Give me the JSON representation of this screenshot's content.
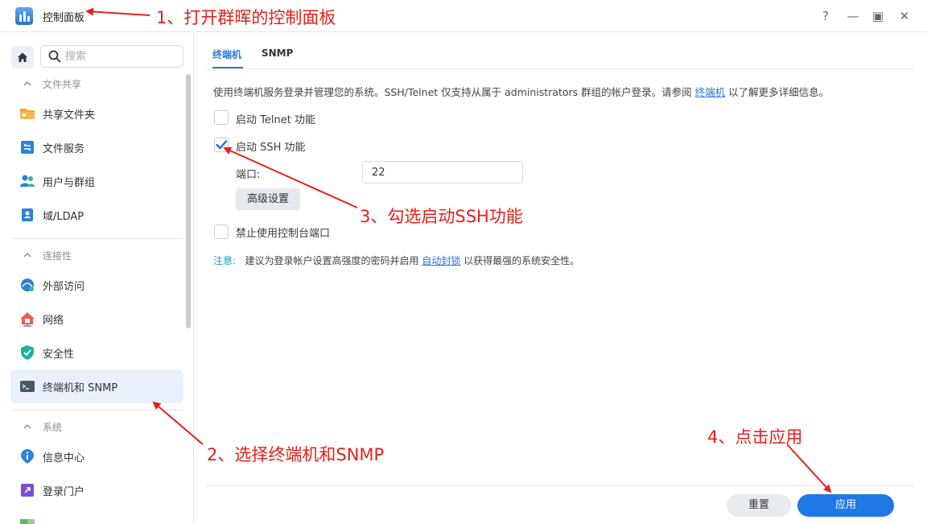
{
  "window": {
    "title": "控制面板",
    "buttons": {
      "help": "?",
      "minimize": "—",
      "maximize": "▣",
      "close": "✕"
    }
  },
  "sidebar": {
    "search_placeholder": "搜索",
    "groups": [
      {
        "label": "文件共享",
        "items": [
          "共享文件夹",
          "文件服务",
          "用户与群组",
          "域/LDAP"
        ]
      },
      {
        "label": "连接性",
        "items": [
          "外部访问",
          "网络",
          "安全性",
          "终端机和 SNMP"
        ]
      },
      {
        "label": "系统",
        "items": [
          "信息中心",
          "登录门户"
        ]
      }
    ],
    "active_item": "终端机和 SNMP"
  },
  "main": {
    "tabs": [
      "终端机",
      "SNMP"
    ],
    "active_tab": "终端机",
    "description": {
      "before": "使用终端机服务登录并管理您的系统。SSH/Telnet 仅支持从属于 administrators 群组的帐户登录。请参阅 ",
      "link": "终端机",
      "after": " 以了解更多详细信息。"
    },
    "telnet": {
      "label": "启动 Telnet 功能",
      "checked": false
    },
    "ssh": {
      "label": "启动 SSH 功能",
      "checked": true
    },
    "port": {
      "label": "端口:",
      "value": "22"
    },
    "advanced_button": "高级设置",
    "console": {
      "label": "禁止使用控制台端口",
      "checked": false
    },
    "note": {
      "label": "注意:",
      "before": "建议为登录帐户设置高强度的密码并启用 ",
      "link": "自动封锁",
      "after": " 以获得最强的系统安全性。"
    },
    "footer": {
      "reset": "重置",
      "apply": "应用"
    }
  },
  "annotations": [
    "1、打开群晖的控制面板",
    "2、选择终端机和SNMP",
    "3、勾选启动SSH功能",
    "4、点击应用"
  ],
  "colors": {
    "accent": "#1f78e4",
    "annotation": "#e4211c",
    "active_bg": "#e8f1fb"
  }
}
